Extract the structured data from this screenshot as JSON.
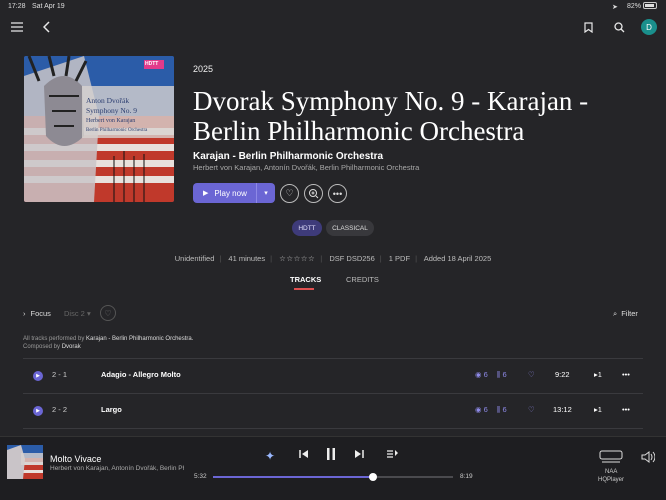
{
  "status_bar": {
    "time": "17:28",
    "date": "Sat Apr 19",
    "battery": "82%"
  },
  "album": {
    "year": "2025",
    "title": "Dvorak Symphony No. 9 - Karajan - Berlin Philharmonic Orchestra",
    "artist": "Karajan - Berlin Philharmonic Orchestra",
    "sub_artists": "Herbert von Karajan, Antonín Dvořák, Berlin Philharmonic Orchestra",
    "cover": {
      "label_line1": "Anton Dvořák",
      "label_line2": "Symphony No. 9",
      "label_line3": "Herbert von Karajan",
      "label_line4": "Berlin Philharmonic Orchestra",
      "badge": "HDTT"
    }
  },
  "actions": {
    "play_label": "Play now"
  },
  "tags": [
    "HDTT",
    "CLASSICAL"
  ],
  "meta": {
    "status": "Unidentified",
    "duration": "41 minutes",
    "rating": "☆☆☆☆☆",
    "format": "DSF DSD256",
    "pdf": "1 PDF",
    "added": "Added 18 April 2025"
  },
  "tabs": [
    {
      "label": "TRACKS",
      "active": true
    },
    {
      "label": "CREDITS",
      "active": false
    }
  ],
  "toolbar": {
    "focus_label": "Focus",
    "disc_label": "Disc 2",
    "filter_label": "Filter"
  },
  "note": {
    "performed_prefix": "All tracks performed by",
    "performed_by": "Karajan - Berlin Philharmonic Orchestra.",
    "composed_prefix": "Composed by",
    "composed_by": "Dvorak"
  },
  "tracks": [
    {
      "number": "2 - 1",
      "title": "Adagio - Allegro Molto",
      "versions": "6",
      "libraries": "6",
      "duration": "9:22",
      "queue": "1"
    },
    {
      "number": "2 - 2",
      "title": "Largo",
      "versions": "6",
      "libraries": "6",
      "duration": "13:12",
      "queue": "1"
    }
  ],
  "player": {
    "title": "Molto Vivace",
    "artist": "Herbert von Karajan, Antonín Dvořák, Berlin Phil",
    "elapsed": "5:32",
    "total": "8:19",
    "progress_fraction": 0.665,
    "zone_name": "NAA",
    "zone_device": "HQPlayer"
  },
  "avatar_letter": "D",
  "colors": {
    "accent": "#6b66d4",
    "background": "#252528",
    "avatar": "#1a8f8c"
  }
}
